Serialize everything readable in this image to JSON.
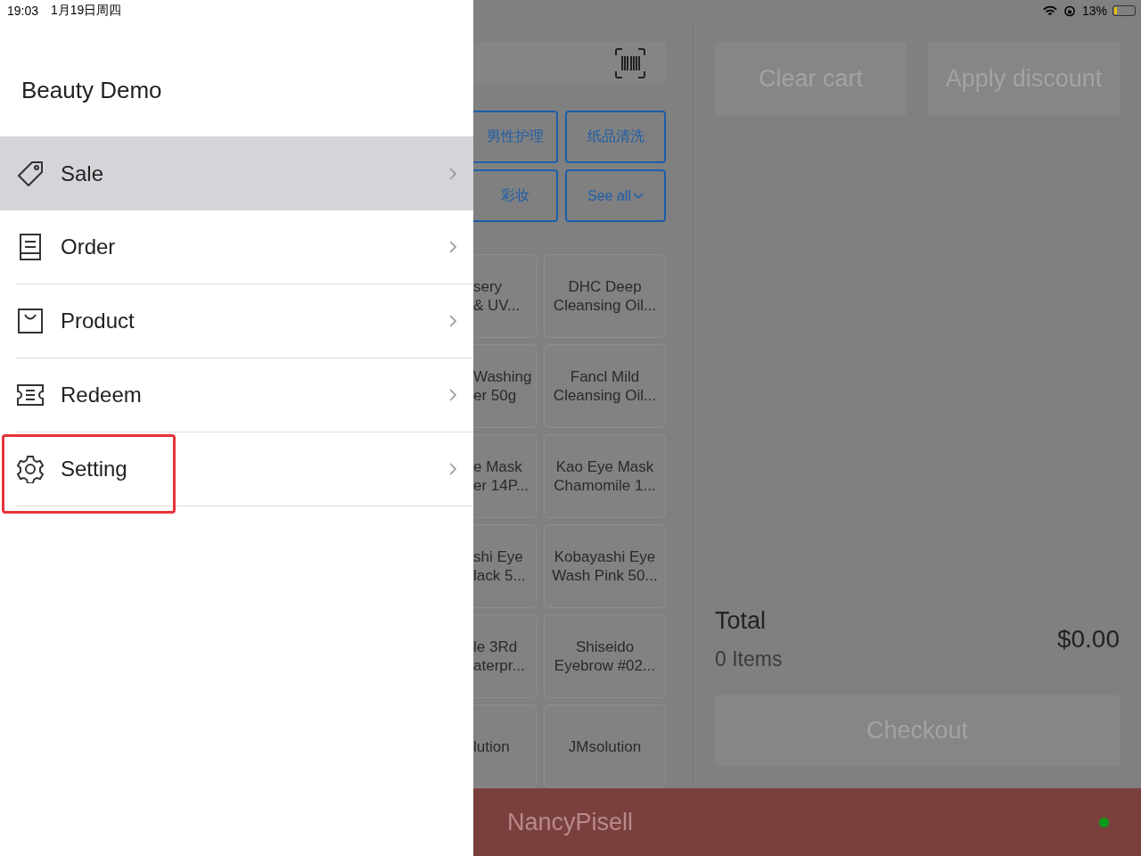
{
  "status_bar": {
    "time": "19:03",
    "date": "1月19日周四",
    "battery": "13%",
    "battery_icon": {
      "level": 0.13
    }
  },
  "drawer": {
    "title": "Beauty Demo",
    "items": [
      {
        "label": "Sale",
        "kind": "tag",
        "selected": true,
        "highlighted": false
      },
      {
        "label": "Order",
        "kind": "receipt",
        "selected": false,
        "highlighted": false
      },
      {
        "label": "Product",
        "kind": "bag",
        "selected": false,
        "highlighted": false
      },
      {
        "label": "Redeem",
        "kind": "ticket",
        "selected": false,
        "highlighted": false
      },
      {
        "label": "Setting",
        "kind": "gear",
        "selected": false,
        "highlighted": true
      }
    ]
  },
  "categories": [
    {
      "label": "男性护理",
      "kind": "chip"
    },
    {
      "label": "纸品清洗",
      "kind": "chip"
    },
    {
      "label": "彩妆",
      "kind": "chip"
    },
    {
      "label": "See all",
      "kind": "more"
    }
  ],
  "products": [
    {
      "left": "sery\n& UV...",
      "right": "DHC Deep\nCleansing Oil..."
    },
    {
      "left": "Washing\ner 50g",
      "right": "Fancl Mild\nCleansing Oil..."
    },
    {
      "left": "e Mask\ner 14P...",
      "right": "Kao Eye Mask\nChamomile 1..."
    },
    {
      "left": "shi Eye\nlack 5...",
      "right": "Kobayashi Eye\nWash Pink 50..."
    },
    {
      "left": "le 3Rd\naterpr...",
      "right": "Shiseido\nEyebrow #02..."
    },
    {
      "left": "lution",
      "right": "JMsolution"
    }
  ],
  "cart": {
    "buttons": [
      "Clear cart",
      "Apply discount"
    ],
    "total_label": "Total",
    "items": "0 Items",
    "total": "$0.00",
    "checkout": "Checkout"
  },
  "footer": {
    "user": "NancyPisell",
    "online": true
  }
}
